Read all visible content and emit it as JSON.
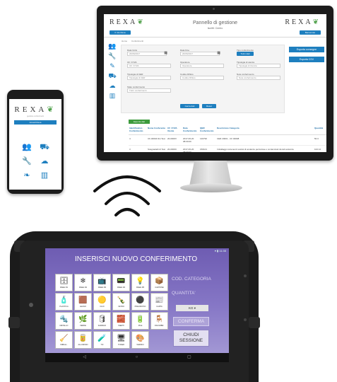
{
  "desktop": {
    "logo": "REXA",
    "title": "Pannello di gestione",
    "subtitle": "Iscritti: Centro",
    "tl_button": "Il mio Rexa",
    "tr_button": "Benvenuto",
    "tabs": [
      "Home",
      "Conferimenti"
    ],
    "fields": {
      "date_from_label": "Data Inizio",
      "date_from": "20/06/2017",
      "date_to_label": "Data Fine",
      "date_to": "20/06/2017",
      "cf_label": "CF / P.IVA",
      "cf": "CF / P.IVA",
      "operator_label": "Operatore",
      "operator": "Operatore",
      "cer_label": "Tipologia di CER",
      "cer": "Tipologia di CER",
      "cod_label": "Codice Rifiuto",
      "cod": "Codice Rifiuto",
      "state_label": "Stato conferimento",
      "state": "Tutti i conferimenti",
      "area_label": "Tipologia di utenza",
      "area": "Tipologia di Utenza",
      "note_label": "Note conferimento",
      "note": "Note conferimento",
      "type_label": "Tipo conferimento",
      "type": "Tipo conferimento",
      "filter_tag": "Tutti i dati",
      "find_button": "Cerca dati",
      "reset_button": "Reset"
    },
    "right_buttons": [
      "Esporta consegne",
      "Esporta CSV"
    ],
    "green_button": "Esporta dati",
    "table": {
      "headers": [
        "Identificativo Conferimento",
        "Nome Conferente",
        "CF / P.IVA Utente",
        "Data Conferimento",
        "QBR Conferimento",
        "Descrizione Categoria",
        "Quantità"
      ],
      "rows": [
        [
          "4",
          "CF-00004 DH Test",
          "20-0000V",
          "2017-06-20 08:00:00",
          "130790",
          "CER 20001 - CF 00008",
          "50.3"
        ],
        [
          "3",
          "Scagnadelli di Test",
          "20-0000C",
          "2017-06-20 08:00:00",
          "150101",
          "Imballaggi contenenti residui di sostanze pericolose o contaminati da tali sostanze",
          "102.12"
        ]
      ]
    }
  },
  "phone": {
    "logo": "REXA",
    "tagline": "gestione conferimenti",
    "button": "Accedi Rexa"
  },
  "tablet": {
    "status": "▾ ▮ 11:35",
    "title": "INSERISCI NUOVO CONFERIMENTO",
    "tiles": [
      {
        "icon": "🗄",
        "label": "RAEE R1"
      },
      {
        "icon": "❄",
        "label": "RAEE R2"
      },
      {
        "icon": "📺",
        "label": "RAEE R3"
      },
      {
        "icon": "📟",
        "label": "RAEE R4"
      },
      {
        "icon": "💡",
        "label": "RAEE R5"
      },
      {
        "icon": "📦",
        "label": "CARTONE"
      },
      {
        "icon": "🧴",
        "label": "PLASTICA"
      },
      {
        "icon": "🟫",
        "label": "LEGNO"
      },
      {
        "icon": "🟡",
        "label": "OLIO"
      },
      {
        "icon": "🍾",
        "label": "VETRO"
      },
      {
        "icon": "⚫",
        "label": "PNEUMATICI"
      },
      {
        "icon": "📰",
        "label": "CARTA"
      },
      {
        "icon": "🔩",
        "label": "METALLO"
      },
      {
        "icon": "🌿",
        "label": "VERDE"
      },
      {
        "icon": "🛢",
        "label": "FARMACI"
      },
      {
        "icon": "🧱",
        "label": "INERTI"
      },
      {
        "icon": "🔋",
        "label": "PILE"
      },
      {
        "icon": "🪑",
        "label": "INGOMBR."
      },
      {
        "icon": "🧹",
        "label": "IMBALL."
      },
      {
        "icon": "🥫",
        "label": "ALLUMINIO"
      },
      {
        "icon": "🧪",
        "label": "T/F"
      },
      {
        "icon": "🖥",
        "label": "TONER"
      },
      {
        "icon": "🎨",
        "label": "VERNICI"
      }
    ],
    "cod_label": "COD. CATEGORIA",
    "qty_label": "QUANTITA'",
    "unit": "KG",
    "confirm": "CONFERMA",
    "close": "CHIUDI\nSESSIONE",
    "nav": "◁ ○ ▢"
  }
}
